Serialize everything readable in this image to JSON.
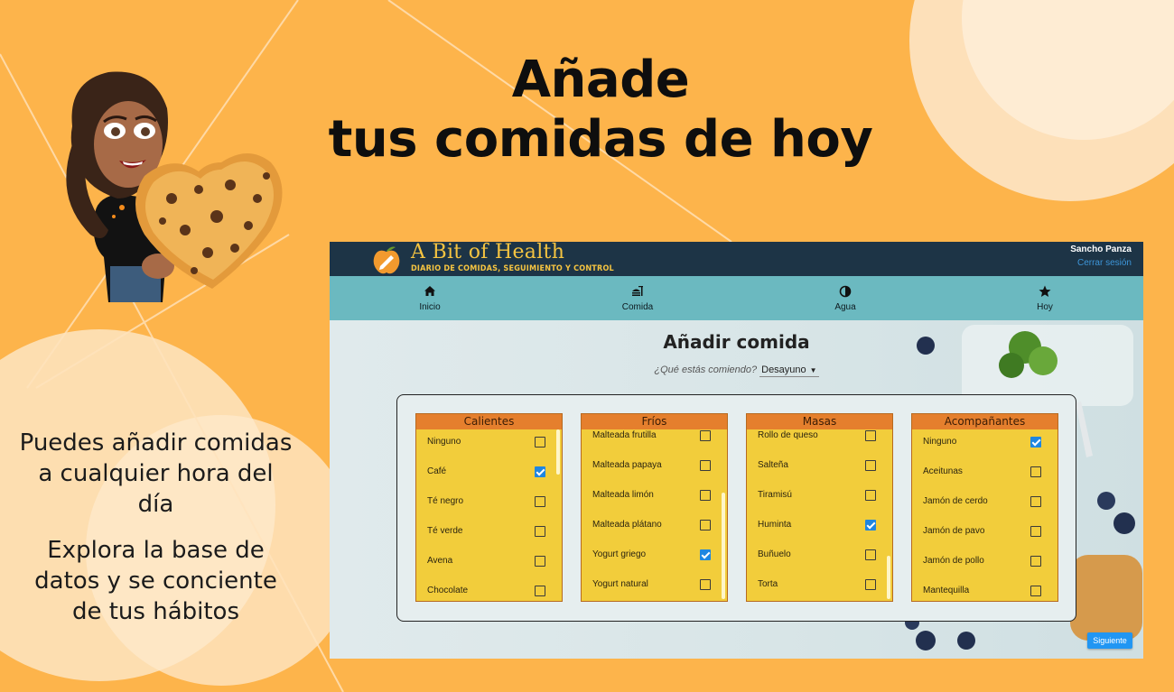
{
  "headline": {
    "line1": "Añade",
    "line2": "tus comidas de hoy"
  },
  "side": {
    "text1": "Puedes añadir comidas a cualquier hora del día",
    "text2": "Explora la base de datos y se conciente de tus hábitos"
  },
  "app": {
    "brand": {
      "title": "A Bit of Health",
      "subtitle": "DIARIO DE COMIDAS, SEGUIMIENTO Y CONTROL",
      "icon": "apple-pencil-icon"
    },
    "user": {
      "name": "Sancho Panza",
      "logout": "Cerrar sesión"
    },
    "nav": [
      {
        "label": "Inicio",
        "icon": "home-icon"
      },
      {
        "label": "Comida",
        "icon": "food-icon"
      },
      {
        "label": "Agua",
        "icon": "water-icon"
      },
      {
        "label": "Hoy",
        "icon": "star-icon"
      }
    ],
    "title": "Añadir comida",
    "question": {
      "label": "¿Qué estás comiendo?",
      "value": "Desayuno"
    },
    "categories": [
      {
        "name": "Calientes",
        "items": [
          {
            "label": "Ninguno",
            "checked": false
          },
          {
            "label": "Café",
            "checked": true
          },
          {
            "label": "Té negro",
            "checked": false
          },
          {
            "label": "Té verde",
            "checked": false
          },
          {
            "label": "Avena",
            "checked": false
          },
          {
            "label": "Chocolate",
            "checked": false
          }
        ]
      },
      {
        "name": "Fríos",
        "items": [
          {
            "label": "Malteada frutilla",
            "checked": false
          },
          {
            "label": "Malteada papaya",
            "checked": false
          },
          {
            "label": "Malteada limón",
            "checked": false
          },
          {
            "label": "Malteada plátano",
            "checked": false
          },
          {
            "label": "Yogurt griego",
            "checked": true
          },
          {
            "label": "Yogurt natural",
            "checked": false
          }
        ]
      },
      {
        "name": "Masas",
        "items": [
          {
            "label": "Rollo de queso",
            "checked": false
          },
          {
            "label": "Salteña",
            "checked": false
          },
          {
            "label": "Tiramisú",
            "checked": false
          },
          {
            "label": "Huminta",
            "checked": true
          },
          {
            "label": "Buñuelo",
            "checked": false
          },
          {
            "label": "Torta",
            "checked": false
          }
        ]
      },
      {
        "name": "Acompañantes",
        "items": [
          {
            "label": "Ninguno",
            "checked": true
          },
          {
            "label": "Aceitunas",
            "checked": false
          },
          {
            "label": "Jamón de cerdo",
            "checked": false
          },
          {
            "label": "Jamón de pavo",
            "checked": false
          },
          {
            "label": "Jamón de pollo",
            "checked": false
          },
          {
            "label": "Mantequilla",
            "checked": false
          }
        ]
      }
    ],
    "next_label": "Siguiente"
  },
  "colors": {
    "background": "#fdb44b",
    "topbar": "#1d3446",
    "navbar": "#6bb9c0",
    "brand": "#f5c441",
    "category_header": "#e57f2d",
    "category_body": "#f2cd3b",
    "checkbox_on": "#1f86e0",
    "link": "#3d95d8"
  }
}
